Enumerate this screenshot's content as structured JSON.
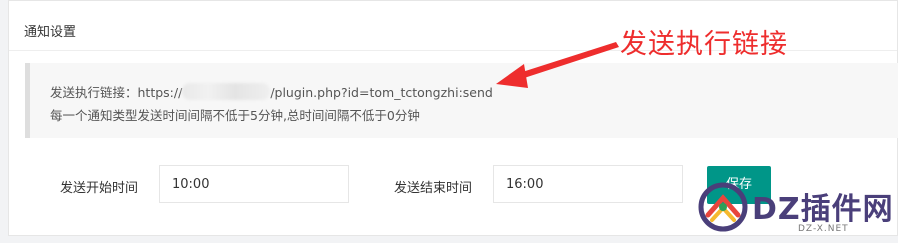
{
  "panel": {
    "title": "通知设置"
  },
  "annotation": {
    "text": "发送执行链接",
    "color": "#ee2d2d"
  },
  "notice": {
    "line1_prefix": "发送执行链接：https://",
    "line1_suffix": "/plugin.php?id=tom_tctongzhi:send",
    "line2": "每一个通知类型发送时间间隔不低于5分钟,总时间间隔不低于0分钟"
  },
  "form": {
    "start_label": "发送开始时间",
    "start_value": "10:00",
    "end_label": "发送结束时间",
    "end_value": "16:00",
    "save_label": "保存",
    "accent": "#009688"
  },
  "watermark": {
    "text": "DZ插件网",
    "sub": "DZ-X.NET",
    "logo_icon": "dz-logo-icon"
  }
}
